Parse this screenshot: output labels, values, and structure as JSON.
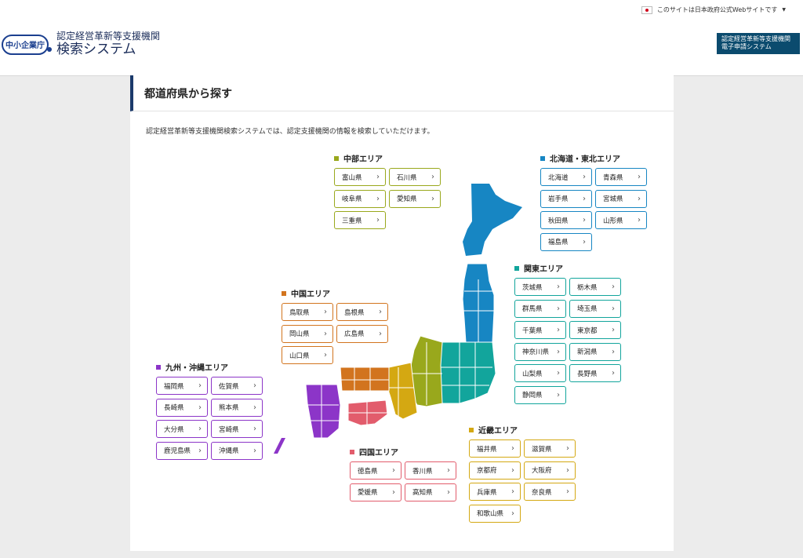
{
  "header": {
    "gov_notice": "このサイトは日本政府公式Webサイトです",
    "logo_badge": "中小企業庁",
    "logo_line1": "認定経営革新等支援機関",
    "logo_line2": "検索システム",
    "apply_button_line1": "認定経営革新等支援機関",
    "apply_button_line2": "電子申請システム"
  },
  "page": {
    "title": "都道府県から探す",
    "description": "認定経営革新等支援機関検索システムでは、認定支援機関の情報を検索していただけます。"
  },
  "regions": {
    "hokkaido_tohoku": {
      "title": "北海道・東北エリア",
      "color": "#1786c3",
      "prefs": [
        "北海道",
        "青森県",
        "岩手県",
        "宮城県",
        "秋田県",
        "山形県",
        "福島県"
      ]
    },
    "kanto": {
      "title": "関東エリア",
      "color": "#12a59c",
      "prefs": [
        "茨城県",
        "栃木県",
        "群馬県",
        "埼玉県",
        "千葉県",
        "東京都",
        "神奈川県",
        "新潟県",
        "山梨県",
        "長野県",
        "静岡県"
      ]
    },
    "chubu": {
      "title": "中部エリア",
      "color": "#99a81c",
      "prefs": [
        "富山県",
        "石川県",
        "岐阜県",
        "愛知県",
        "三重県"
      ]
    },
    "kinki": {
      "title": "近畿エリア",
      "color": "#d4a812",
      "prefs": [
        "福井県",
        "滋賀県",
        "京都府",
        "大阪府",
        "兵庫県",
        "奈良県",
        "和歌山県"
      ]
    },
    "chugoku": {
      "title": "中国エリア",
      "color": "#d2741e",
      "prefs": [
        "鳥取県",
        "島根県",
        "岡山県",
        "広島県",
        "山口県"
      ]
    },
    "shikoku": {
      "title": "四国エリア",
      "color": "#e25c6c",
      "prefs": [
        "徳島県",
        "香川県",
        "愛媛県",
        "高知県"
      ]
    },
    "kyushu": {
      "title": "九州・沖縄エリア",
      "color": "#8c35c8",
      "prefs": [
        "福岡県",
        "佐賀県",
        "長崎県",
        "熊本県",
        "大分県",
        "宮崎県",
        "鹿児島県",
        "沖縄県"
      ]
    }
  }
}
